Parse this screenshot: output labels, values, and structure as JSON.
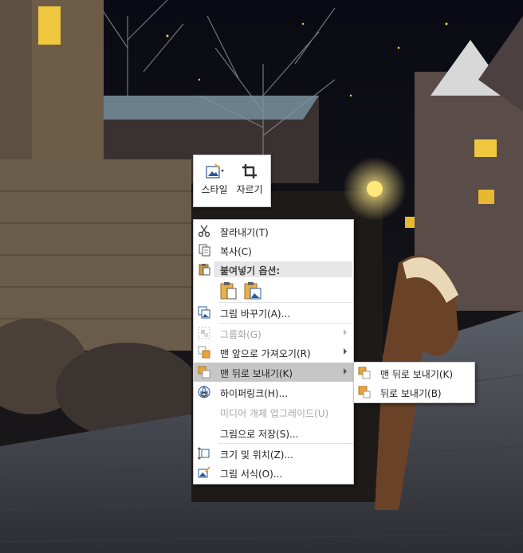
{
  "mini_toolbar": {
    "style_label": "스타일",
    "crop_label": "자르기"
  },
  "menu": {
    "cut": "잘라내기(T)",
    "copy": "복사(C)",
    "paste_header": "붙여넣기 옵션:",
    "change_picture": "그림 바꾸기(A)...",
    "group": "그룹화(G)",
    "bring_to_front": "맨 앞으로 가져오기(R)",
    "send_to_back": "맨 뒤로 보내기(K)",
    "hyperlink": "하이퍼링크(H)...",
    "media_upgrade": "미디어 개체 업그레이드(U)",
    "save_as_picture": "그림으로 저장(S)...",
    "size_position": "크기 및 위치(Z)...",
    "format_picture": "그림 서식(O)..."
  },
  "submenu": {
    "send_to_back": "맨 뒤로 보내기(K)",
    "send_backward": "뒤로 보내기(B)"
  },
  "icons": {
    "style": "picture-style-icon",
    "crop": "crop-icon",
    "cut": "scissors-icon",
    "copy": "copy-icon",
    "paste": "paste-icon",
    "change_picture": "change-picture-icon",
    "group": "group-icon",
    "bring_front": "bring-to-front-icon",
    "send_back": "send-to-back-icon",
    "hyperlink": "link-icon",
    "size": "size-position-icon",
    "format": "format-picture-icon"
  },
  "colors": {
    "highlight": "#c6c6c6",
    "orange_accent": "#e8a33c",
    "blue_accent": "#2b5797",
    "disabled_text": "#a6a6a6"
  }
}
